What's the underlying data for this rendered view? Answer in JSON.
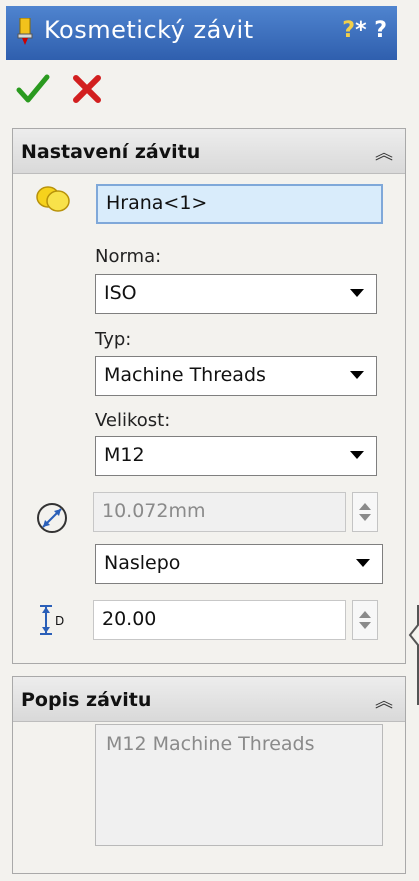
{
  "title": "Kosmetický závit",
  "help": {
    "tip_icon": "help-tip-icon",
    "q": "?"
  },
  "actions": {
    "ok_icon": "checkmark-icon",
    "cancel_icon": "close-icon"
  },
  "settings": {
    "header": "Nastavení závitu",
    "edge_value": "Hrana<1>",
    "norma_label": "Norma:",
    "norma_value": "ISO",
    "typ_label": "Typ:",
    "typ_value": "Machine Threads",
    "velikost_label": "Velikost:",
    "velikost_value": "M12",
    "diameter_value": "10.072mm",
    "end_condition": "Naslepo",
    "depth_value": "20.00",
    "depth_icon_label": "D"
  },
  "description": {
    "header": "Popis závitu",
    "text": "M12 Machine Threads"
  },
  "colors": {
    "titlebar": "#3a6fc0",
    "ok": "#2a9a1f",
    "cancel": "#d21f1f"
  }
}
